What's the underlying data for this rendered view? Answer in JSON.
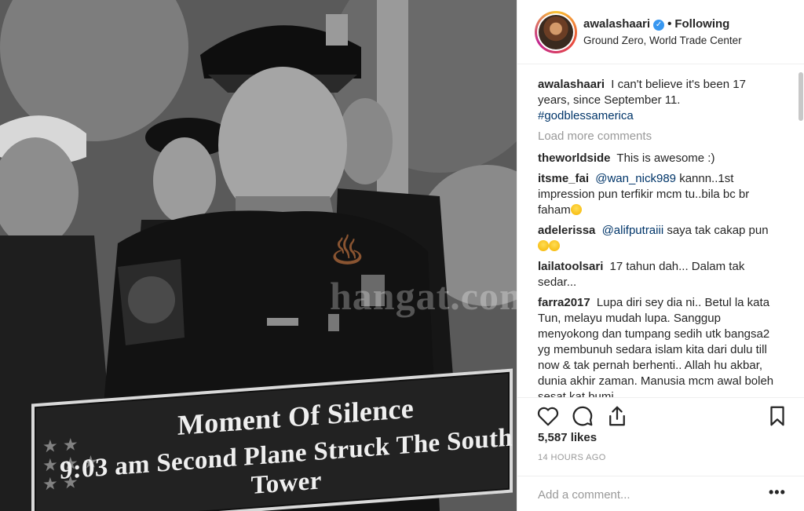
{
  "post": {
    "username": "awalashaari",
    "verified_icon": "verified-badge-icon",
    "separator": "•",
    "follow_status": "Following",
    "location": "Ground Zero, World Trade Center",
    "load_more": "Load more comments",
    "likes": "5,587 likes",
    "timestamp": "14 HOURS AGO",
    "add_comment_placeholder": "Add a comment...",
    "more_options": "•••"
  },
  "caption": {
    "user": "awalashaari",
    "text": "I can't believe it's been 17 years, since September 11.",
    "hashtag": "#godblessamerica"
  },
  "comments": [
    {
      "user": "theworldside",
      "mention": "",
      "text": "This is awesome :)",
      "emoji": ""
    },
    {
      "user": "itsme_fai",
      "mention": "@wan_nick989",
      "text": "kannn..1st impression pun terfikir mcm tu..bila bc br faham",
      "emoji": "grin"
    },
    {
      "user": "adelerissa",
      "mention": "@alifputraiii",
      "text": "saya tak cakap pun",
      "emoji": "laugh laugh"
    },
    {
      "user": "lailatoolsari",
      "mention": "",
      "text": "17 tahun dah... Dalam tak sedar...",
      "emoji": ""
    },
    {
      "user": "farra2017",
      "mention": "",
      "text": "Lupa diri sey dia ni.. Betul la kata Tun, melayu mudah lupa. Sanggup menyokong dan tumpang sedih utk bangsa2 yg membunuh sedara islam kita dari dulu till now & tak pernah berhenti.. Allah hu akbar, dunia akhir zaman. Manusia mcm awal boleh sesat kat bumi",
      "emoji": ""
    }
  ],
  "photo": {
    "banner_line1": "Moment Of Silence",
    "banner_line2": "9:03 am Second Plane Struck The South Tower",
    "watermark": "hangat.com"
  },
  "colors": {
    "link": "#003569",
    "verified": "#3897f0",
    "muted": "#999999",
    "text": "#262626"
  }
}
